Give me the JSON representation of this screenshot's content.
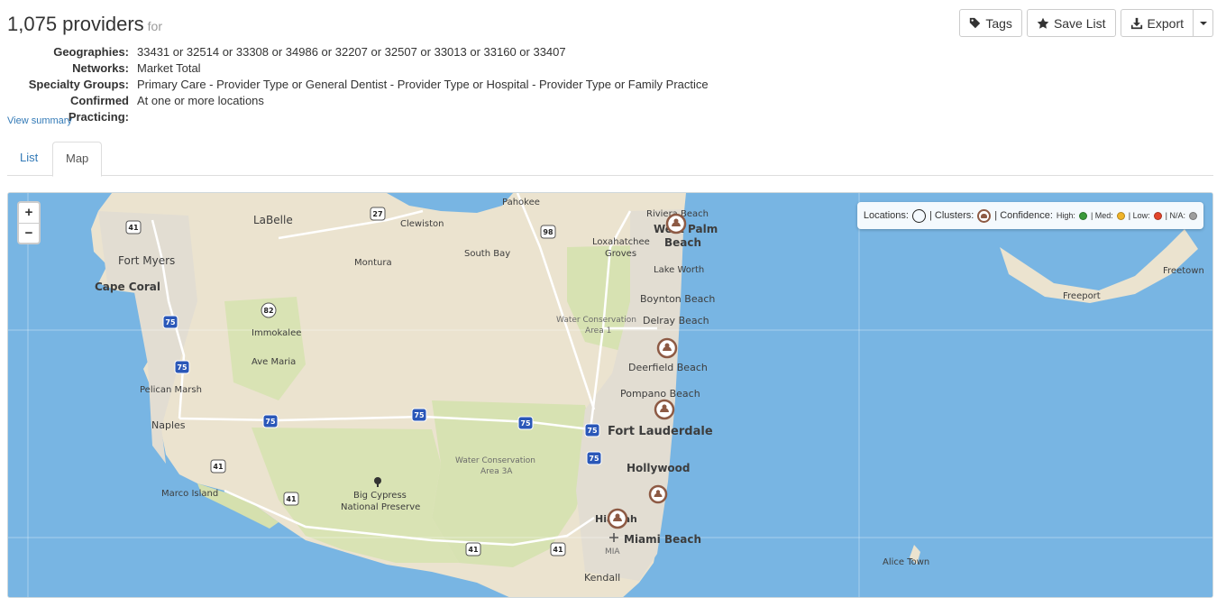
{
  "header": {
    "count_title": "1,075 providers",
    "for_label": "for"
  },
  "criteria": [
    {
      "label": "Geographies:",
      "value": "33431 or 32514 or 33308 or 34986 or 32207 or 32507 or 33013 or 33160 or 33407"
    },
    {
      "label": "Networks:",
      "value": "Market Total"
    },
    {
      "label": "Specialty Groups:",
      "value": "Primary Care - Provider Type or General Dentist - Provider Type or Hospital - Provider Type or Family Practice"
    },
    {
      "label": "Confirmed Practicing:",
      "value": "At one or more locations"
    }
  ],
  "view_summary": "View summary",
  "tabs": [
    {
      "label": "List",
      "active": false
    },
    {
      "label": "Map",
      "active": true
    }
  ],
  "toolbar": {
    "tags_label": "Tags",
    "tags_icon": "tag-icon",
    "save_list_label": "Save List",
    "save_list_icon": "star-icon",
    "export_label": "Export",
    "export_icon": "download-icon"
  },
  "map": {
    "zoom_in": "+",
    "zoom_out": "−",
    "legend": {
      "locations": "Locations:",
      "clusters": "| Clusters:",
      "confidence": "| Confidence:",
      "high": "High:",
      "med": "| Med:",
      "low": "| Low:",
      "na": "| N/A:",
      "colors": {
        "high": "#3a9a3a",
        "med": "#f0b429",
        "low": "#e2452b",
        "na": "#9e9e9e"
      }
    },
    "places": {
      "pahokee": "Pahokee",
      "labelle": "LaBelle",
      "clewiston": "Clewiston",
      "riviera_beach": "Riviera Beach",
      "west_palm": "West Palm",
      "beach": "Beach",
      "fort_myers": "Fort Myers",
      "montura": "Montura",
      "south_bay": "South Bay",
      "loxahatchee": "Loxahatchee",
      "groves": "Groves",
      "lake_worth": "Lake Worth",
      "cape_coral": "Cape Coral",
      "boynton_beach": "Boynton Beach",
      "water_cons_1a": "Water Conservation",
      "area_1": "Area 1",
      "delray_beach": "Delray Beach",
      "immokalee": "Immokalee",
      "ave_maria": "Ave Maria",
      "deerfield_beach": "Deerfield Beach",
      "pelican_marsh": "Pelican Marsh",
      "pompano_beach": "Pompano Beach",
      "naples": "Naples",
      "fort_lauderdale": "Fort Lauderdale",
      "water_cons_3a": "Water Conservation",
      "area_3a": "Area 3A",
      "hollywood": "Hollywood",
      "marco_island": "Marco Island",
      "big_cypress": "Big Cypress",
      "national_preserve": "National Preserve",
      "hialeah": "Hialeah",
      "miami_beach": "Miami Beach",
      "mia": "MIA",
      "kendall": "Kendall",
      "freetown": "Freetown",
      "freeport": "Freeport",
      "alice_town": "Alice Town"
    },
    "shields": {
      "us41_a": "41",
      "us27": "27",
      "us98": "98",
      "cr82": "82",
      "i75_a": "75",
      "i75_b": "75",
      "i75_c": "75",
      "i75_d": "75",
      "i75_e": "75",
      "i75_f": "75",
      "i75_g": "75",
      "us41_b": "41",
      "us41_c": "41",
      "us41_d": "41",
      "us41_e": "41"
    }
  }
}
